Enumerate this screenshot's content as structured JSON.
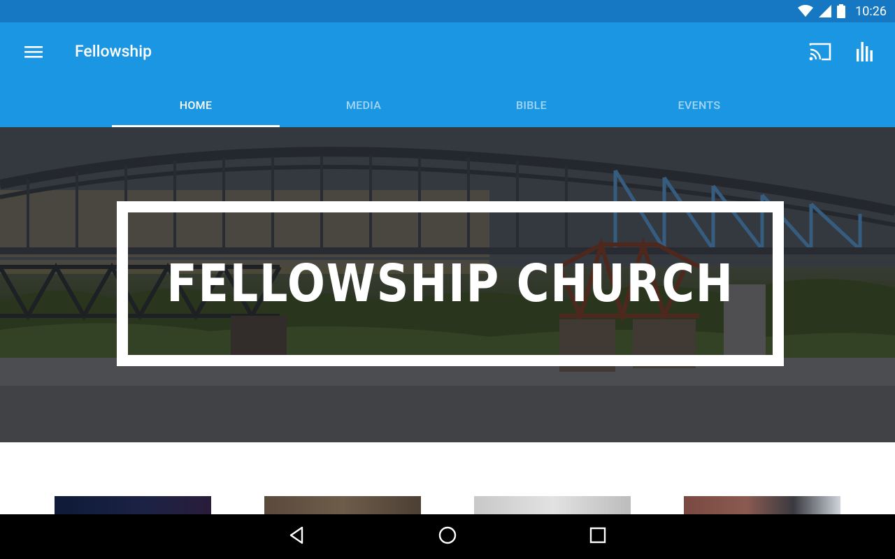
{
  "status_bar": {
    "time": "10:26",
    "icons": [
      "wifi-icon",
      "signal-icon",
      "battery-icon"
    ]
  },
  "app_bar": {
    "title": "Fellowship",
    "menu_icon": "menu-icon",
    "actions": [
      "cast-icon",
      "stats-icon"
    ],
    "background": "#1a96e3"
  },
  "tabs": [
    {
      "label": "HOME",
      "active": true
    },
    {
      "label": "MEDIA",
      "active": false
    },
    {
      "label": "BIBLE",
      "active": false
    },
    {
      "label": "EVENTS",
      "active": false
    }
  ],
  "hero": {
    "title": "FELLOWSHIP CHURCH"
  },
  "nav_bar": {
    "buttons": [
      "back-icon",
      "home-icon",
      "recents-icon"
    ]
  }
}
